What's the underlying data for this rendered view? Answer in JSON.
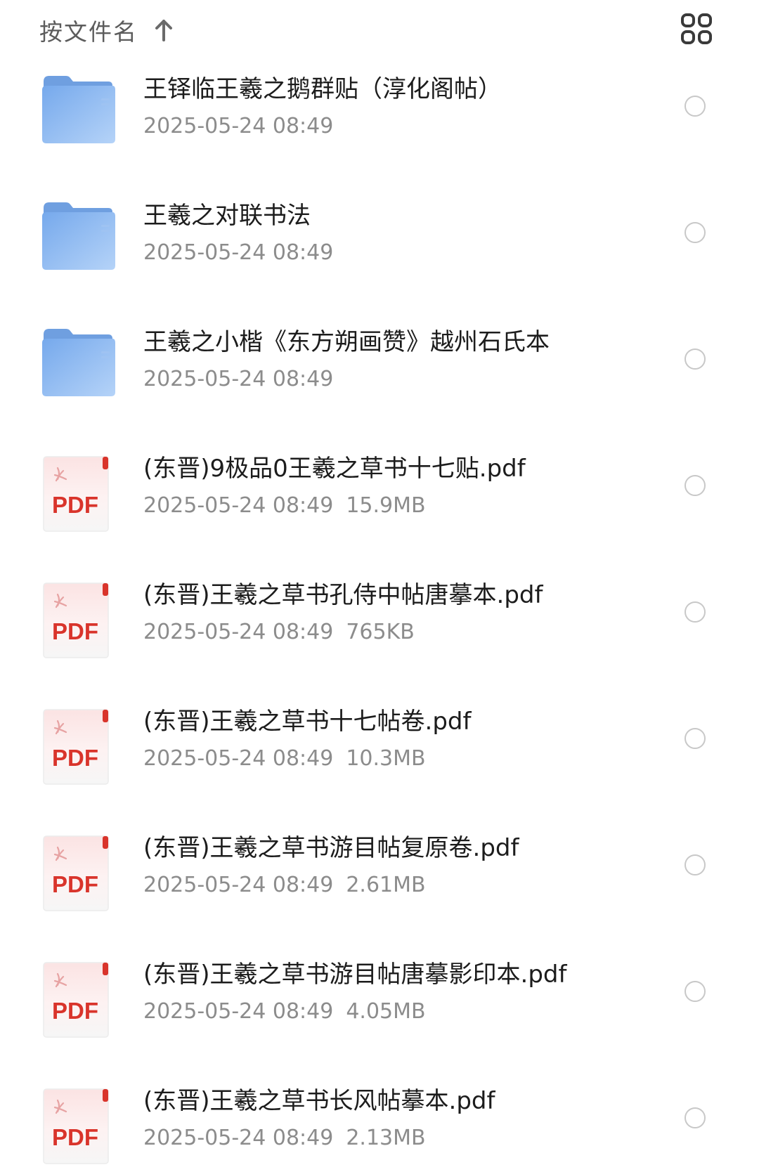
{
  "sort_bar": {
    "sort_label": "按文件名",
    "sort_direction_icon": "arrow-up-icon",
    "view_toggle_icon": "grid-view-icon"
  },
  "colors": {
    "folder_blue": "#7fb2ee",
    "pdf_red": "#d9342b",
    "text_primary": "#1c1c1c",
    "text_secondary": "#8c8c8c"
  },
  "files": [
    {
      "type": "folder",
      "icon": "folder-icon",
      "name": "王铎临王羲之鹅群贴（淳化阁帖）",
      "date": "2025-05-24 08:49",
      "size": ""
    },
    {
      "type": "folder",
      "icon": "folder-icon",
      "name": "王羲之对联书法",
      "date": "2025-05-24 08:49",
      "size": ""
    },
    {
      "type": "folder",
      "icon": "folder-icon",
      "name": "王羲之小楷《东方朔画赞》越州石氏本",
      "date": "2025-05-24 08:49",
      "size": ""
    },
    {
      "type": "pdf",
      "icon": "pdf-file-icon",
      "badge": "PDF",
      "name": "(东晋)9极品0王羲之草书十七贴.pdf",
      "date": "2025-05-24 08:49",
      "size": "15.9MB"
    },
    {
      "type": "pdf",
      "icon": "pdf-file-icon",
      "badge": "PDF",
      "name": "(东晋)王羲之草书孔侍中帖唐摹本.pdf",
      "date": "2025-05-24 08:49",
      "size": "765KB"
    },
    {
      "type": "pdf",
      "icon": "pdf-file-icon",
      "badge": "PDF",
      "name": "(东晋)王羲之草书十七帖卷.pdf",
      "date": "2025-05-24 08:49",
      "size": "10.3MB"
    },
    {
      "type": "pdf",
      "icon": "pdf-file-icon",
      "badge": "PDF",
      "name": "(东晋)王羲之草书游目帖复原卷.pdf",
      "date": "2025-05-24 08:49",
      "size": "2.61MB"
    },
    {
      "type": "pdf",
      "icon": "pdf-file-icon",
      "badge": "PDF",
      "name": "(东晋)王羲之草书游目帖唐摹影印本.pdf",
      "date": "2025-05-24 08:49",
      "size": "4.05MB"
    },
    {
      "type": "pdf",
      "icon": "pdf-file-icon",
      "badge": "PDF",
      "name": "(东晋)王羲之草书长风帖摹本.pdf",
      "date": "2025-05-24 08:49",
      "size": "2.13MB"
    }
  ]
}
